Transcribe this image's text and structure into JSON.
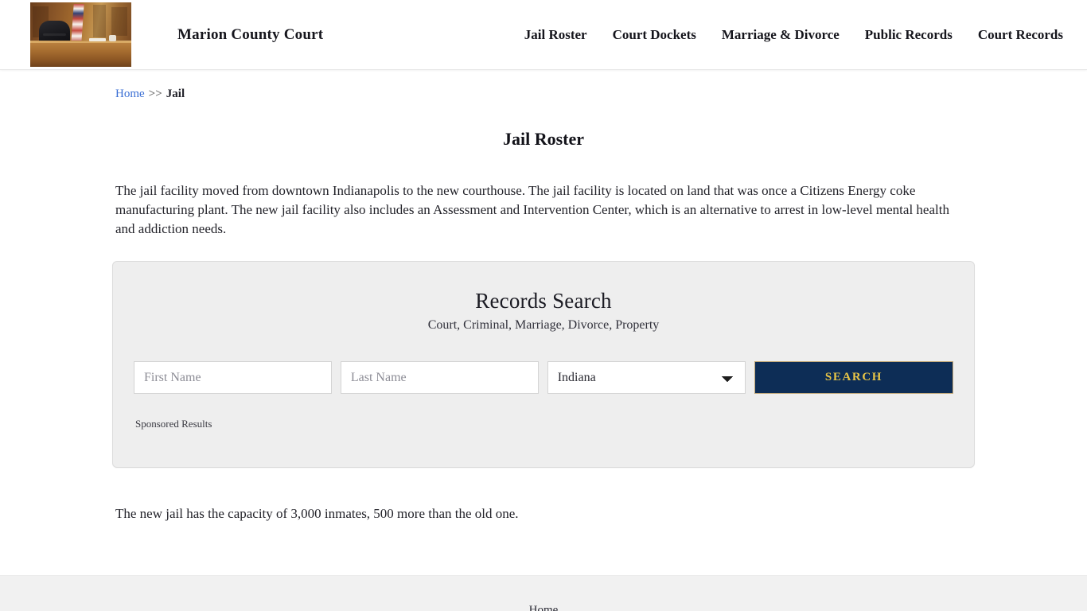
{
  "header": {
    "site_title": "Marion County Court",
    "logo_alt": "courtroom-photo",
    "nav": [
      {
        "label": "Jail Roster"
      },
      {
        "label": "Court Dockets"
      },
      {
        "label": "Marriage & Divorce"
      },
      {
        "label": "Public Records"
      },
      {
        "label": "Court Records"
      }
    ]
  },
  "breadcrumb": {
    "home": "Home",
    "separator": ">>",
    "current": "Jail"
  },
  "page": {
    "title": "Jail Roster",
    "intro": "The jail facility moved from downtown Indianapolis to the new courthouse. The jail facility is located on land that was once a Citizens Energy coke manufacturing plant. The new jail facility also includes an Assessment and Intervention Center, which is an alternative to arrest in low-level mental health and addiction needs.",
    "outro": "The new jail has the capacity of 3,000 inmates, 500 more than the old one."
  },
  "search_panel": {
    "heading": "Records Search",
    "subheading": "Court, Criminal, Marriage, Divorce, Property",
    "first_name_placeholder": "First Name",
    "first_name_value": "",
    "last_name_placeholder": "Last Name",
    "last_name_value": "",
    "state_selected": "Indiana",
    "state_options": [
      "Indiana"
    ],
    "search_button": "SEARCH",
    "sponsored_label": "Sponsored Results",
    "accent_navy": "#0d2d56",
    "accent_gold": "#e8c547",
    "panel_background": "#eeeeee"
  },
  "footer": {
    "links": [
      {
        "label": "Home"
      }
    ]
  }
}
